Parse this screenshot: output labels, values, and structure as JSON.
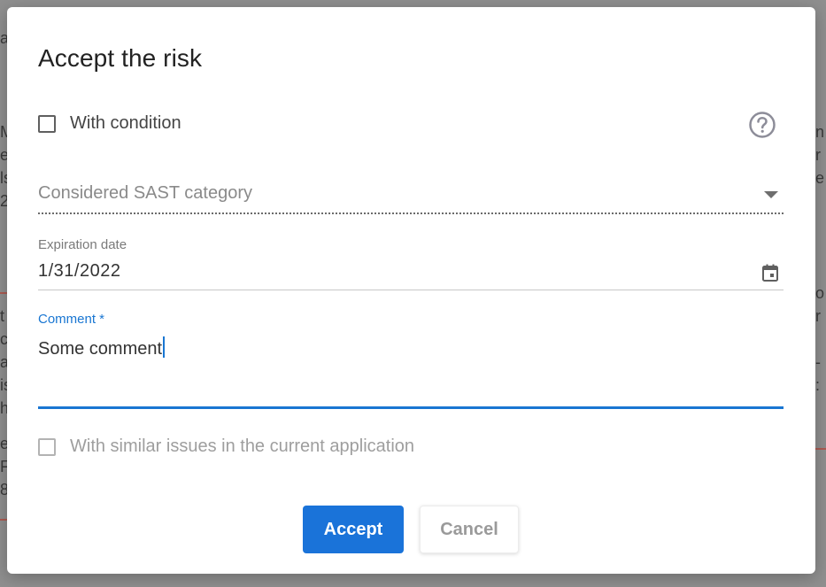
{
  "dialog": {
    "title": "Accept the risk",
    "with_condition": {
      "label": "With condition",
      "checked": false
    },
    "help_icon": "help-circle-icon",
    "category_select": {
      "placeholder": "Considered SAST category",
      "value": ""
    },
    "expiration": {
      "label": "Expiration date",
      "value": "1/31/2022"
    },
    "comment": {
      "label": "Comment *",
      "value": "Some comment"
    },
    "similar_issues": {
      "label": "With similar issues in the current application",
      "checked": false,
      "disabled": true
    },
    "buttons": {
      "accept": "Accept",
      "cancel": "Cancel"
    }
  },
  "colors": {
    "primary": "#1a73d9",
    "focus": "#1976d2",
    "overlay": "#8f8f8f"
  }
}
